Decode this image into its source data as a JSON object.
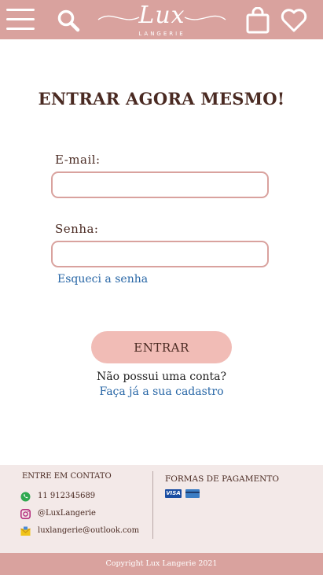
{
  "colors": {
    "brand": "#d9a29e",
    "button": "#f1bcb6",
    "link": "#2766a6",
    "text": "#4a2a22",
    "footer_bg": "#f3e9e8"
  },
  "header": {
    "logo_text": "Lux",
    "logo_subtext": "LANGERIE",
    "icons": [
      "menu-icon",
      "search-icon",
      "shopping-bag-icon",
      "heart-icon"
    ]
  },
  "login": {
    "title": "ENTRAR AGORA MESMO!",
    "email_label": "E-mail:",
    "email_value": "",
    "password_label": "Senha:",
    "password_value": "",
    "forgot_link": "Esqueci a senha",
    "submit_label": "ENTRAR",
    "no_account_text": "Não possui uma conta?",
    "register_link": "Faça já a sua cadastro"
  },
  "footer": {
    "contact_title": "ENTRE EM CONTATO",
    "contacts": [
      {
        "icon": "whatsapp-icon",
        "text": "11 912345689"
      },
      {
        "icon": "instagram-icon",
        "text": "@LuxLangerie"
      },
      {
        "icon": "mail-icon",
        "text": "luxlangerie@outlook.com"
      }
    ],
    "payment_title": "FORMAS DE PAGAMENTO",
    "payment_methods": [
      "VISA",
      "credit-card"
    ],
    "copyright": "Copyright Lux Langerie 2021"
  }
}
